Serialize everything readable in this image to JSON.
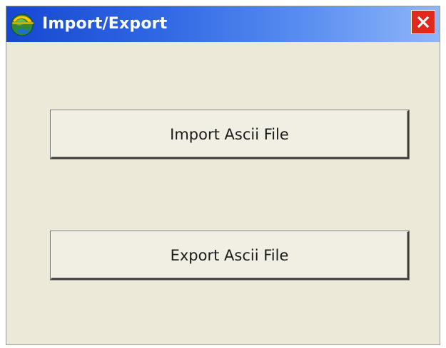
{
  "window": {
    "title": "Import/Export",
    "icon": "app-logo-icon",
    "close_icon": "close-icon"
  },
  "buttons": {
    "import_label": "Import Ascii File",
    "export_label": "Export Ascii File"
  },
  "colors": {
    "titlebar_start": "#1547d0",
    "titlebar_end": "#8fb6f8",
    "close_button": "#e0291c",
    "window_background": "#ece9d8"
  }
}
